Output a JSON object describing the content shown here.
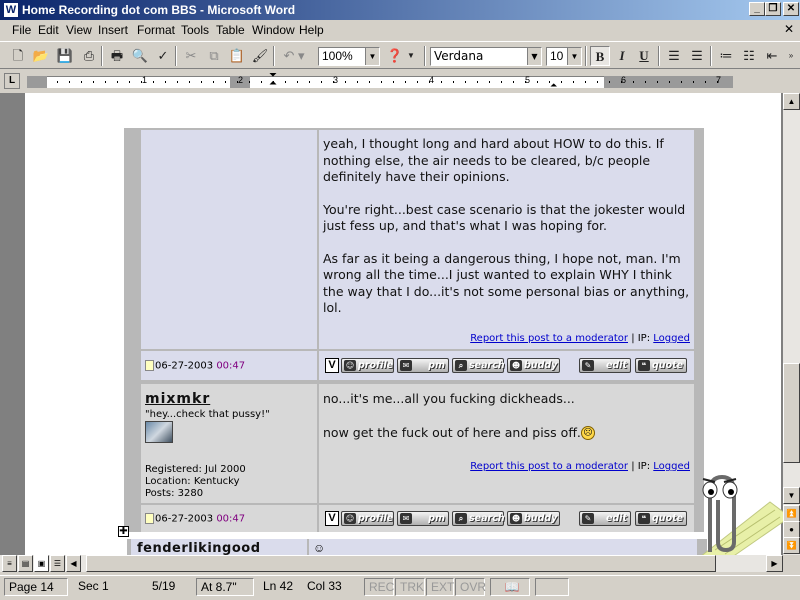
{
  "window": {
    "title": "Home Recording dot com BBS - Microsoft Word",
    "app_icon": "W"
  },
  "menu": [
    "File",
    "Edit",
    "View",
    "Insert",
    "Format",
    "Tools",
    "Table",
    "Window",
    "Help"
  ],
  "toolbar": {
    "zoom": "100%",
    "font": "Verdana",
    "size": "10"
  },
  "ruler": {
    "numbers": [
      "1",
      "2",
      "3",
      "4",
      "5",
      "6",
      "7"
    ]
  },
  "post1": {
    "paragraphs": [
      "yeah, I thought long and hard about HOW to do this. If nothing else, the air needs to be cleared, b/c people definitely have their opinions.",
      "You're right...best case scenario is that the jokester would just fess up, and that's what I was hoping for.",
      "As far as it being a dangerous thing, I hope not, man. I'm wrong all the time...I just wanted to explain WHY I think the way that I do...it's not some personal bias or anything, lol."
    ],
    "report": "Report this post to a moderator",
    "ip_label": "| IP:",
    "logged": "Logged",
    "date": "06-27-2003",
    "time": "00:47"
  },
  "buttons": {
    "profile": "profile",
    "pm": "pm",
    "search": "search",
    "buddy": "buddy",
    "edit": "edit",
    "quote": "quote",
    "v": "V"
  },
  "post2": {
    "username": "mixmkr",
    "user_title": "\"hey...check that pussy!\"",
    "registered": "Registered: Jul 2000",
    "location": "Location: Kentucky",
    "posts": "Posts: 3280",
    "line1": "no...it's me...all you fucking dickheads...",
    "line2": "now get the fuck out of here and piss off.",
    "report": "Report this post to a moderator",
    "ip_label": "| IP:",
    "logged": "Logged",
    "date": "06-27-2003",
    "time": "00:47"
  },
  "post3": {
    "username": "fenderlikingood"
  },
  "status": {
    "page": "Page 14",
    "sec": "Sec 1",
    "pages": "5/19",
    "at": "At 8.7\"",
    "ln": "Ln 42",
    "col": "Col 33",
    "rec": "REC",
    "trk": "TRK",
    "ext": "EXT",
    "ovr": "OVR"
  }
}
